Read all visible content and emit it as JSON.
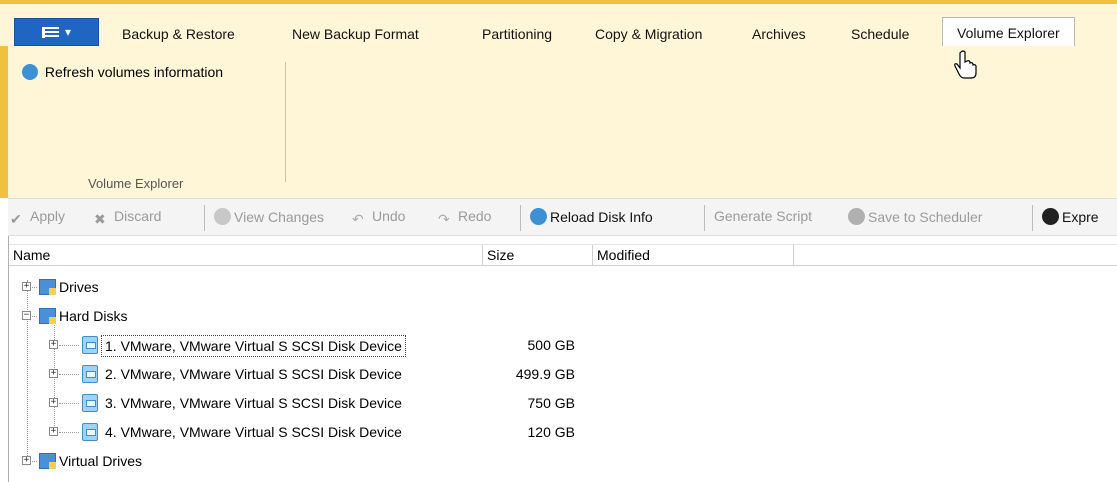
{
  "tabs": [
    {
      "label": "Backup & Restore",
      "active": false
    },
    {
      "label": "New Backup Format",
      "active": false
    },
    {
      "label": "Partitioning",
      "active": false
    },
    {
      "label": "Copy & Migration",
      "active": false
    },
    {
      "label": "Archives",
      "active": false
    },
    {
      "label": "Schedule",
      "active": false
    },
    {
      "label": "Volume Explorer",
      "active": true
    }
  ],
  "ribbon": {
    "refresh_label": "Refresh volumes information",
    "group_label": "Volume Explorer"
  },
  "toolbar": {
    "apply": "Apply",
    "discard": "Discard",
    "view_changes": "View Changes",
    "undo": "Undo",
    "redo": "Redo",
    "reload": "Reload Disk Info",
    "generate_script": "Generate Script",
    "save_scheduler": "Save to Scheduler",
    "express": "Expre"
  },
  "columns": {
    "name": "Name",
    "size": "Size",
    "modified": "Modified"
  },
  "tree": {
    "drives": "Drives",
    "hard_disks": "Hard Disks",
    "virtual_drives": "Virtual Drives",
    "disks": [
      {
        "name": "1. VMware, VMware Virtual S SCSI Disk Device",
        "size": "500 GB"
      },
      {
        "name": "2. VMware, VMware Virtual S SCSI Disk Device",
        "size": "499.9 GB"
      },
      {
        "name": "3. VMware, VMware Virtual S SCSI Disk Device",
        "size": "750 GB"
      },
      {
        "name": "4. VMware, VMware Virtual S SCSI Disk Device",
        "size": "120 GB"
      }
    ]
  },
  "colors": {
    "ribbon_bg": "#fff6d8",
    "accent": "#f0c040",
    "app_button": "#1f66c2"
  }
}
